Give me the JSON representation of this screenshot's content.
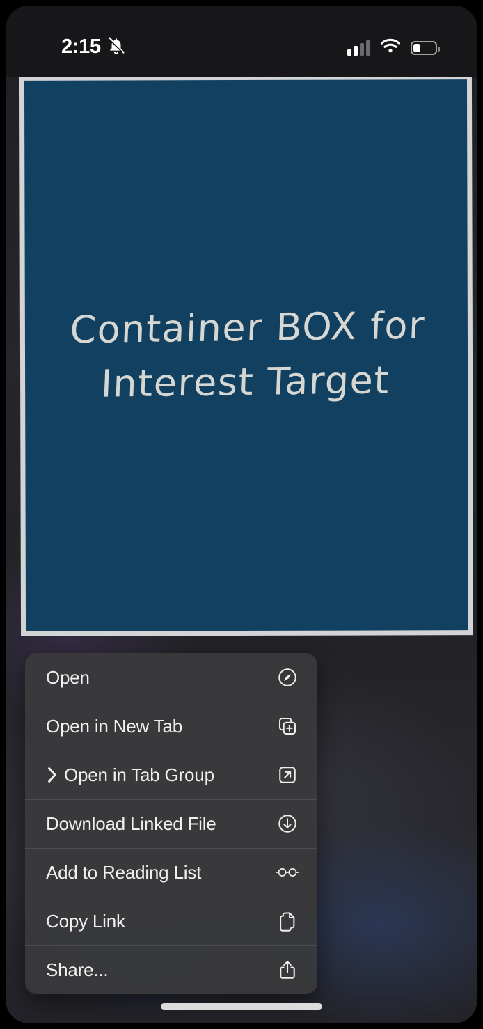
{
  "status_bar": {
    "time": "2:15",
    "silent_icon": "bell-slash-icon",
    "signal_icon": "cellular-signal-icon",
    "wifi_icon": "wifi-icon",
    "battery_icon": "battery-low-icon",
    "battery_level_percent": 25
  },
  "content_box": {
    "text": "Container BOX for\nInterest Target",
    "fill_color": "#114060",
    "border_color": "#d3d4d6",
    "text_color": "#d6d7d3"
  },
  "context_menu": {
    "background_color": "#3a3a3c",
    "items": [
      {
        "label": "Open",
        "icon": "compass-icon",
        "has_submenu": false
      },
      {
        "label": "Open in New Tab",
        "icon": "new-tab-icon",
        "has_submenu": false
      },
      {
        "label": "Open in Tab Group",
        "icon": "open-external-icon",
        "has_submenu": true
      },
      {
        "label": "Download Linked File",
        "icon": "download-circle-icon",
        "has_submenu": false
      },
      {
        "label": "Add to Reading List",
        "icon": "eyeglasses-icon",
        "has_submenu": false
      },
      {
        "label": "Copy Link",
        "icon": "copy-documents-icon",
        "has_submenu": false
      },
      {
        "label": "Share...",
        "icon": "share-icon",
        "has_submenu": false
      }
    ]
  },
  "home_indicator": {
    "name": "home-indicator"
  }
}
